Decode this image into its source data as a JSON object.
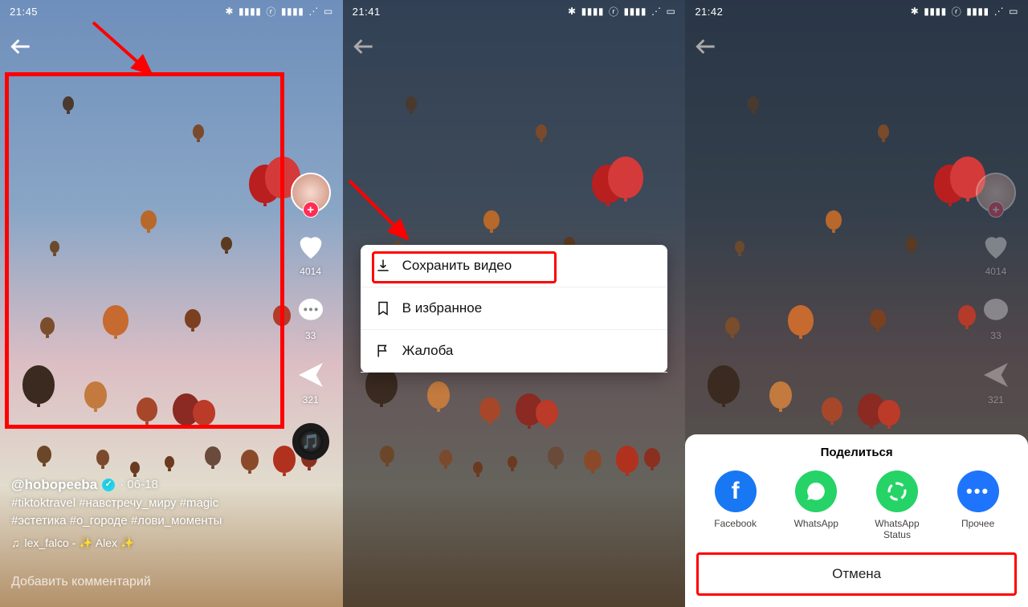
{
  "screens": [
    {
      "time": "21:45"
    },
    {
      "time": "21:41"
    },
    {
      "time": "21:42"
    }
  ],
  "post": {
    "handle": "@hobopeeba",
    "date": "06-18",
    "caption": "#tiktoktravel #навстречу_миру #magic #эстетика #о_городе #лови_моменты",
    "music_author": "lex_falco",
    "music_title": "Alex",
    "like_count": "4014",
    "comment_count": "33",
    "share_count": "321",
    "add_comment": "Добавить комментарий"
  },
  "context_menu": {
    "save": "Сохранить видео",
    "fav": "В избранное",
    "report": "Жалоба"
  },
  "share_sheet": {
    "title": "Поделиться",
    "facebook": "Facebook",
    "whatsapp": "WhatsApp",
    "whatsapp_status": "WhatsApp Status",
    "more": "Прочее",
    "cancel": "Отмена"
  }
}
